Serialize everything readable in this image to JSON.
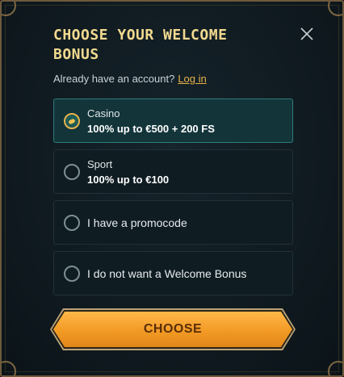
{
  "dialog": {
    "title": "CHOOSE YOUR WELCOME BONUS",
    "close_icon": "close-icon"
  },
  "account": {
    "prompt": "Already have an account?",
    "login_label": "Log in"
  },
  "options": [
    {
      "category": "Casino",
      "offer": "100% up to €500 + 200 FS",
      "selected": true
    },
    {
      "category": "Sport",
      "offer": "100% up to €100",
      "selected": false
    },
    {
      "label": "I have a promocode",
      "selected": false
    },
    {
      "label": "I do not want a Welcome Bonus",
      "selected": false
    }
  ],
  "choose_button": {
    "label": "CHOOSE"
  },
  "colors": {
    "accent": "#f29a24",
    "title": "#f2d98f",
    "link": "#e8b24a",
    "selected_border": "#2f7c79"
  }
}
